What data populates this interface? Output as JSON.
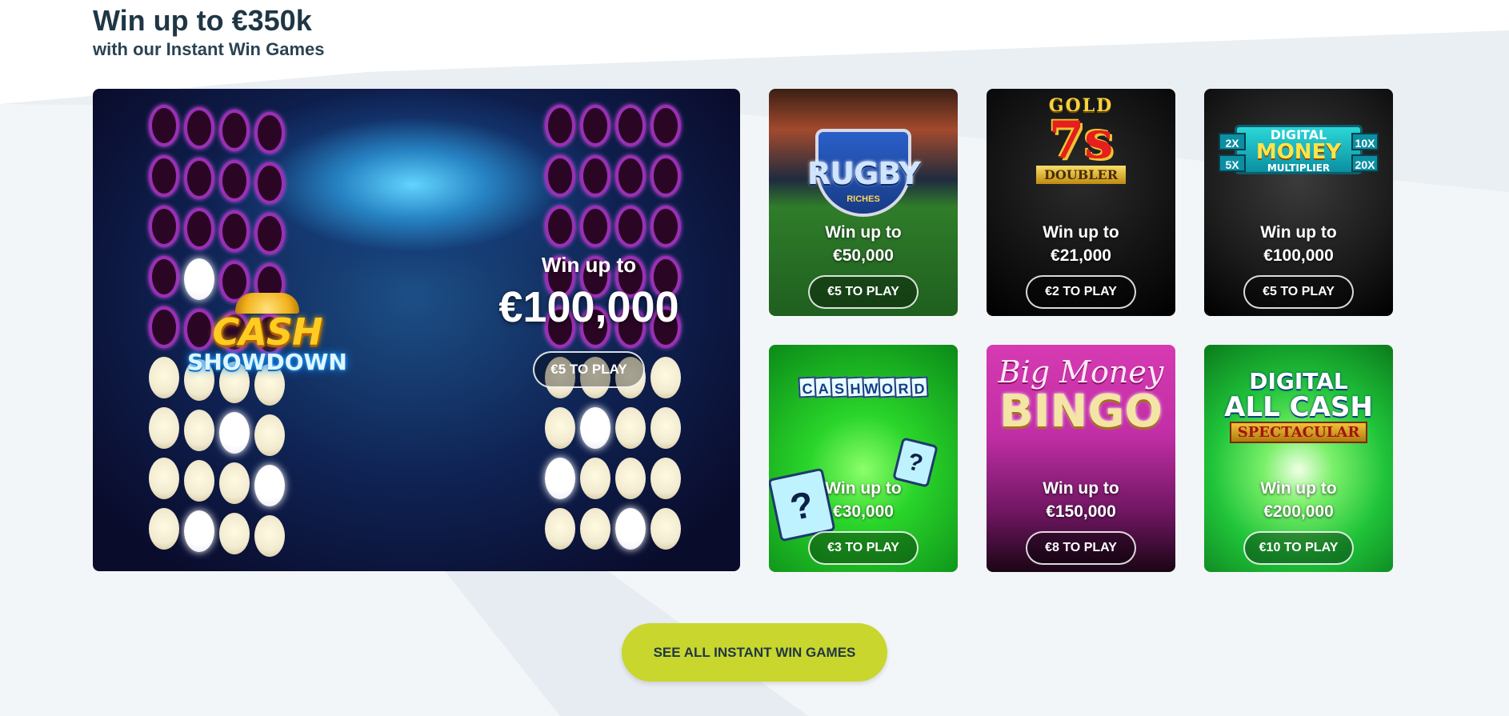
{
  "section": {
    "title": "Win up to €350k",
    "subtitle": "with our Instant Win Games"
  },
  "hero": {
    "logo_line1": "CASH",
    "logo_line2": "SHOWDOWN",
    "win_label": "Win up to",
    "amount": "€100,000",
    "play_label": "€5 TO PLAY"
  },
  "cards": [
    {
      "name": "rugby-riches",
      "logo_main": "RUGBY",
      "logo_sub": "RICHES",
      "win_label": "Win up to",
      "amount": "€50,000",
      "play_label": "€5 TO PLAY"
    },
    {
      "name": "gold-7s-doubler",
      "logo_top": "GOLD",
      "logo_main": "7s",
      "logo_sub": "DOUBLER",
      "win_label": "Win up to",
      "amount": "€21,000",
      "play_label": "€2 TO PLAY"
    },
    {
      "name": "digital-money-multiplier",
      "logo_top": "DIGITAL",
      "logo_main": "MONEY",
      "logo_sub": "MULTIPLIER",
      "multipliers": [
        "2X",
        "5X",
        "10X",
        "20X"
      ],
      "win_label": "Win up to",
      "amount": "€100,000",
      "play_label": "€5 TO PLAY"
    },
    {
      "name": "cashword",
      "logo_letters": [
        "C",
        "A",
        "S",
        "H",
        "W",
        "O",
        "R",
        "D"
      ],
      "tile_glyph": "?",
      "win_label": "Win up to",
      "amount": "€30,000",
      "play_label": "€3 TO PLAY"
    },
    {
      "name": "big-money-bingo",
      "logo_script": "Big Money",
      "logo_main": "BINGO",
      "win_label": "Win up to",
      "amount": "€150,000",
      "play_label": "€8 TO PLAY"
    },
    {
      "name": "digital-all-cash-spectacular",
      "logo_top": "DIGITAL",
      "logo_main": "ALL CASH",
      "logo_sub": "SPECTACULAR",
      "win_label": "Win up to",
      "amount": "€200,000",
      "play_label": "€10 TO PLAY"
    }
  ],
  "cta": {
    "label": "SEE ALL INSTANT WIN GAMES"
  },
  "colors": {
    "heading": "#1f3645",
    "cta_bg": "#c8d62e",
    "swoosh": "#eef2f5"
  }
}
